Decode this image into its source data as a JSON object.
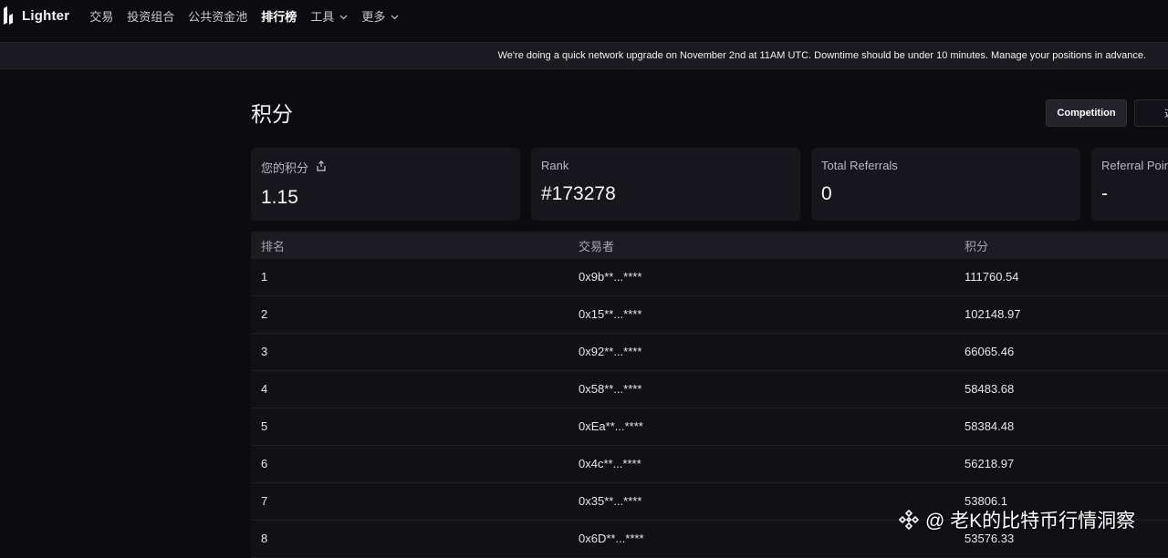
{
  "nav": {
    "brand": "Lighter",
    "items": [
      {
        "label": "交易",
        "dropdown": false,
        "active": false
      },
      {
        "label": "投资组合",
        "dropdown": false,
        "active": false
      },
      {
        "label": "公共资金池",
        "dropdown": false,
        "active": false
      },
      {
        "label": "排行榜",
        "dropdown": false,
        "active": true
      },
      {
        "label": "工具",
        "dropdown": true,
        "active": false
      },
      {
        "label": "更多",
        "dropdown": true,
        "active": false
      }
    ]
  },
  "banner": {
    "text": "We're doing a quick network upgrade on November 2nd at 11AM UTC. Downtime should be under 10 minutes. Manage your positions in advance."
  },
  "page": {
    "title": "积分",
    "buttons": {
      "competition": "Competition",
      "second": "遊"
    }
  },
  "cards": [
    {
      "label": "您的积分",
      "value": "1.15"
    },
    {
      "label": "Rank",
      "value": "#173278"
    },
    {
      "label": "Total Referrals",
      "value": "0"
    },
    {
      "label": "Referral Points",
      "value": "-"
    }
  ],
  "table": {
    "headers": [
      "排名",
      "交易者",
      "积分"
    ],
    "rows": [
      [
        "1",
        "0x9b**...****",
        "111760.54"
      ],
      [
        "2",
        "0x15**...****",
        "102148.97"
      ],
      [
        "3",
        "0x92**...****",
        "66065.46"
      ],
      [
        "4",
        "0x58**...****",
        "58483.68"
      ],
      [
        "5",
        "0xEa**...****",
        "58384.48"
      ],
      [
        "6",
        "0x4c**...****",
        "56218.97"
      ],
      [
        "7",
        "0x35**...****",
        "53806.1"
      ],
      [
        "8",
        "0x6D**...****",
        "53576.33"
      ]
    ]
  },
  "watermark": {
    "text": "@ 老K的比特币行情洞察"
  }
}
